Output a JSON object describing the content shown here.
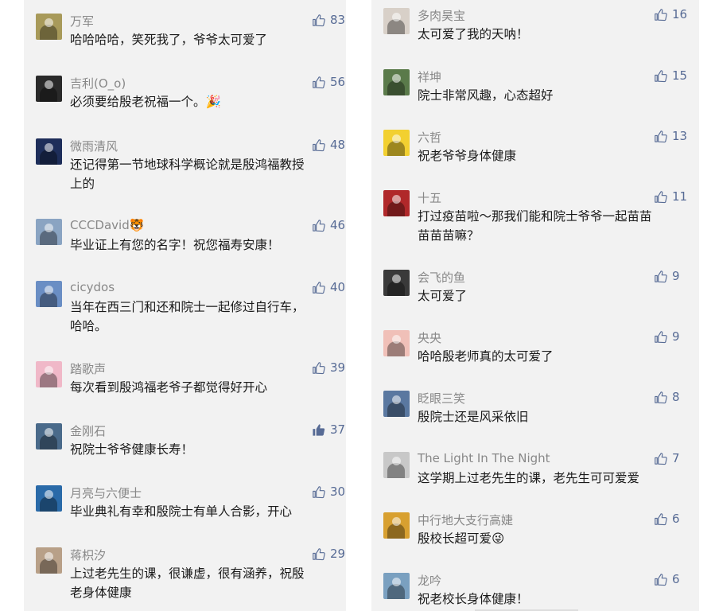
{
  "left": [
    {
      "name": "万军",
      "lines": [
        "哈哈哈哈，笑死我了，爷爷太可爱了"
      ],
      "likes": "83",
      "avatar_color": "#a89a5a",
      "liked": false
    },
    {
      "name": "吉利(O_o)",
      "lines": [
        "必须要给殷老祝福一个。🎉"
      ],
      "likes": "56",
      "avatar_color": "#2a2a2a",
      "liked": false
    },
    {
      "name": "微雨清风",
      "lines": [
        "还记得第一节地球科学概论就是殷鸿福教授",
        "上的"
      ],
      "likes": "48",
      "avatar_color": "#1e2e5a",
      "liked": false
    },
    {
      "name": "CCCDavid🐯",
      "lines": [
        "毕业证上有您的名字！祝您福寿安康！"
      ],
      "likes": "46",
      "avatar_color": "#8aa4c2",
      "liked": false
    },
    {
      "name": "cicydos",
      "lines": [
        "当年在西三门和还和院士一起修过自行车，",
        "哈哈。"
      ],
      "likes": "40",
      "avatar_color": "#6a8ec4",
      "liked": false
    },
    {
      "name": "踏歌声",
      "lines": [
        "每次看到殷鸿福老爷子都觉得好开心"
      ],
      "likes": "39",
      "avatar_color": "#f0b8c8",
      "liked": false
    },
    {
      "name": "金刚石",
      "lines": [
        "祝院士爷爷健康长寿！"
      ],
      "likes": "37",
      "avatar_color": "#4a6a8a",
      "liked": true
    },
    {
      "name": "月亮与六便士",
      "lines": [
        "毕业典礼有幸和殷院士有单人合影，开心"
      ],
      "likes": "30",
      "avatar_color": "#2a6aa8",
      "liked": false
    },
    {
      "name": "蒋枳汐",
      "lines": [
        "上过老先生的课，很谦虚，很有涵养，祝殷",
        "老身体健康"
      ],
      "likes": "29",
      "avatar_color": "#b8a088",
      "liked": false
    }
  ],
  "right": [
    {
      "name": "多肉昊宝",
      "lines": [
        "太可爱了我的天呐！"
      ],
      "likes": "16",
      "avatar_color": "#d8d0c8",
      "liked": false
    },
    {
      "name": "祥坤",
      "lines": [
        "院士非常风趣，心态超好"
      ],
      "likes": "15",
      "avatar_color": "#5a7a4a",
      "liked": false
    },
    {
      "name": "六哲",
      "lines": [
        "祝老爷爷身体健康"
      ],
      "likes": "13",
      "avatar_color": "#f2d030",
      "liked": false
    },
    {
      "name": "十五",
      "lines": [
        "打过疫苗啦～那我们能和院士爷爷一起苗苗",
        "苗苗苗嘛？"
      ],
      "likes": "11",
      "avatar_color": "#b0282a",
      "liked": false
    },
    {
      "name": "会飞的鱼",
      "lines": [
        "太可爱了"
      ],
      "likes": "9",
      "avatar_color": "#3a3a3a",
      "liked": false
    },
    {
      "name": "央央",
      "lines": [
        "哈哈殷老师真的太可爱了"
      ],
      "likes": "9",
      "avatar_color": "#f0c0b8",
      "liked": false
    },
    {
      "name": "眨眼三笑",
      "lines": [
        "殷院士还是风采依旧"
      ],
      "likes": "8",
      "avatar_color": "#5a78a0",
      "liked": false
    },
    {
      "name": "The Light In The Night",
      "lines": [
        "这学期上过老先生的课，老先生可可爱爱"
      ],
      "likes": "7",
      "avatar_color": "#c8c8c8",
      "liked": false
    },
    {
      "name": "中行地大支行高婕",
      "lines": [
        "殷校长超可爱😜"
      ],
      "likes": "6",
      "avatar_color": "#d8a030",
      "liked": false
    },
    {
      "name": "龙吟",
      "lines": [
        "祝老校长身体健康！"
      ],
      "likes": "6",
      "avatar_color": "#7aa0c0",
      "liked": false
    }
  ],
  "colors": {
    "name": "#888888",
    "text": "#1a1a1a",
    "likes": "#576b95",
    "panel_bg": "#f2f2f2"
  }
}
